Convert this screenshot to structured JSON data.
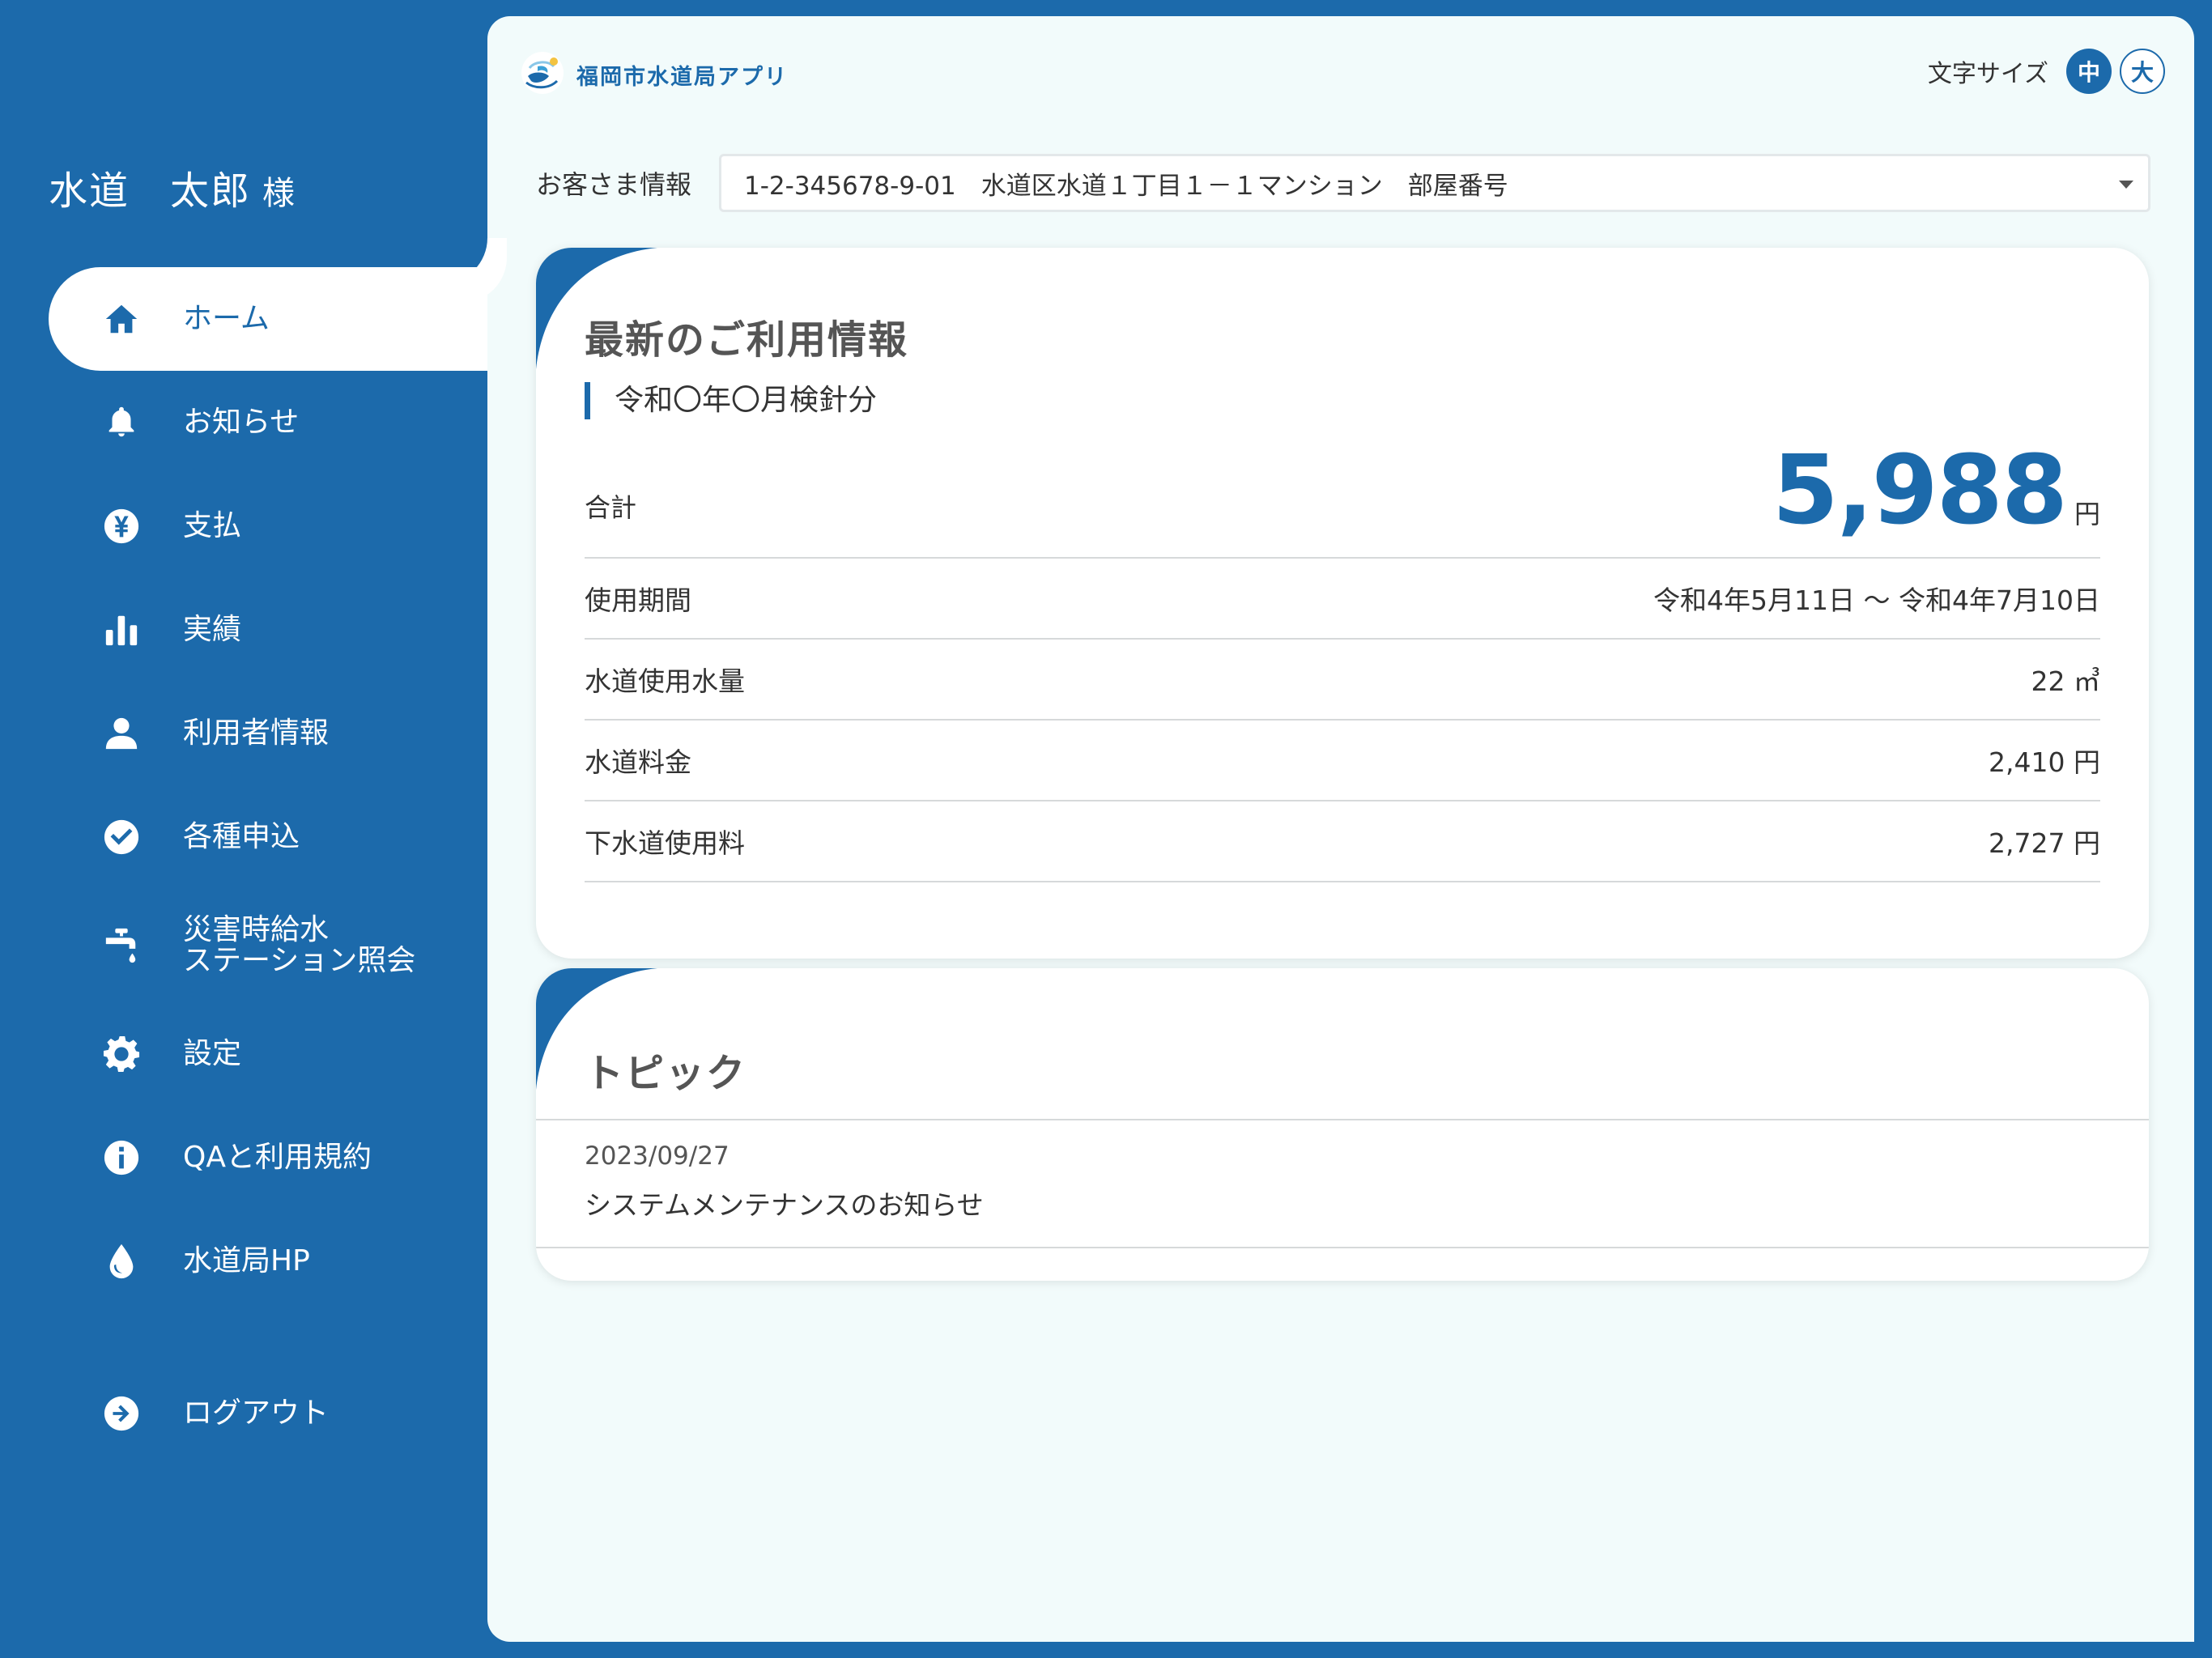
{
  "user": {
    "name": "水道　太郎",
    "honorific": "様"
  },
  "nav": {
    "items": [
      {
        "label": "ホーム",
        "icon": "home-icon"
      },
      {
        "label": "お知らせ",
        "icon": "bell-icon"
      },
      {
        "label": "支払",
        "icon": "yen-icon"
      },
      {
        "label": "実績",
        "icon": "bar-chart-icon"
      },
      {
        "label": "利用者情報",
        "icon": "user-icon"
      },
      {
        "label": "各種申込",
        "icon": "check-circle-icon"
      },
      {
        "label_line1": "災害時給水",
        "label_line2": "ステーション照会",
        "icon": "faucet-icon"
      },
      {
        "label": "設定",
        "icon": "gear-icon"
      },
      {
        "label": "QAと利用規約",
        "icon": "info-icon"
      },
      {
        "label": "水道局HP",
        "icon": "water-drop-icon"
      }
    ],
    "logout": {
      "label": "ログアウト",
      "icon": "arrow-right-circle-icon"
    },
    "active_index": 0
  },
  "header": {
    "app_title": "福岡市水道局アプリ",
    "font_size_label": "文字サイズ",
    "font_size_options": [
      "中",
      "大"
    ],
    "font_size_selected": "中"
  },
  "customer": {
    "label": "お客さま情報",
    "selected": "1-2-345678-9-01　水道区水道１丁目１－１マンション　部屋番号"
  },
  "usage": {
    "title": "最新のご利用情報",
    "period_tag": "令和〇年〇月検針分",
    "total_label": "合計",
    "total_value": "5,988",
    "total_unit": "円",
    "rows": [
      {
        "label": "使用期間",
        "value": "令和4年5月11日 〜 令和4年7月10日"
      },
      {
        "label": "水道使用水量",
        "value": "22 ㎥"
      },
      {
        "label": "水道料金",
        "value": "2,410 円"
      },
      {
        "label": "下水道使用料",
        "value": "2,727 円"
      }
    ]
  },
  "topics": {
    "title": "トピック",
    "items": [
      {
        "date": "2023/09/27",
        "text": "システムメンテナンスのお知らせ"
      }
    ]
  },
  "colors": {
    "brand": "#1c6aab",
    "panel_bg": "#f2fbfb",
    "card_bg": "#ffffff"
  }
}
